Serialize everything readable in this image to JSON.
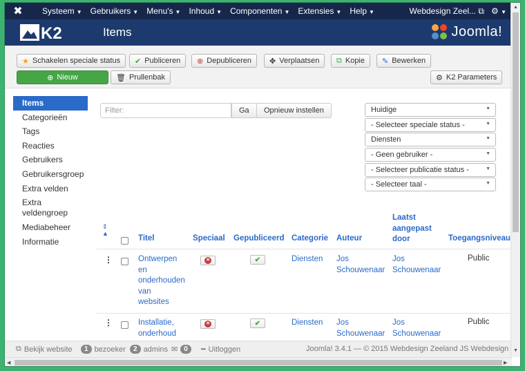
{
  "navbar": {
    "menus": [
      "Systeem",
      "Gebruikers",
      "Menu's",
      "Inhoud",
      "Componenten",
      "Extensies",
      "Help"
    ],
    "site_name": "Webdesign Zeel..."
  },
  "header": {
    "logo": "K2",
    "title": "Items",
    "brand": "Joomla!"
  },
  "toolbar": {
    "special": "Schakelen speciale status",
    "publish": "Publiceren",
    "unpublish": "Depubliceren",
    "move": "Verplaatsen",
    "copy": "Kopie",
    "edit": "Bewerken",
    "new": "Nieuw",
    "trash": "Prullenbak",
    "params": "K2 Parameters"
  },
  "sidebar": {
    "items": [
      "Items",
      "Categorieën",
      "Tags",
      "Reacties",
      "Gebruikers",
      "Gebruikersgroep",
      "Extra velden",
      "Extra veldengroep",
      "Mediabeheer",
      "Informatie"
    ]
  },
  "filter": {
    "placeholder": "Filter:",
    "go": "Ga",
    "reset": "Opnieuw instellen"
  },
  "selects": [
    "Huidige",
    "- Selecteer speciale status -",
    "Diensten",
    "- Geen gebruiker -",
    "- Selecteer publicatie status -",
    "- Selecteer taal -"
  ],
  "table": {
    "headers": {
      "title": "Titel",
      "special": "Speciaal",
      "published": "Gepubliceerd",
      "category": "Categorie",
      "author": "Auteur",
      "modified_by": "Laatst aangepast door",
      "access": "Toegangsniveau"
    },
    "rows": [
      {
        "title": "Ontwerpen en onderhouden van websites",
        "category": "Diensten",
        "author": "Jos Schouwenaar",
        "modified_by": "Jos Schouwenaar",
        "access": "Public"
      },
      {
        "title": "Installatie, onderhoud",
        "category": "Diensten",
        "author": "Jos Schouwenaar",
        "modified_by": "Jos Schouwenaar",
        "access": "Public"
      }
    ]
  },
  "footer": {
    "view_site": "Bekijk website",
    "visitors_count": "1",
    "visitors_label": "bezoeker",
    "admins_count": "2",
    "admins_label": "admins",
    "messages_count": "0",
    "logout": "Uitloggen",
    "version": "Joomla! 3.4.1 — © 2015 Webdesign Zeeland JS Webdesign"
  },
  "colors": {
    "navbar": "#17274c",
    "header": "#1c3a6e",
    "accent": "#2a6ac8",
    "new_button": "#46a546",
    "frame": "#3cb371"
  }
}
